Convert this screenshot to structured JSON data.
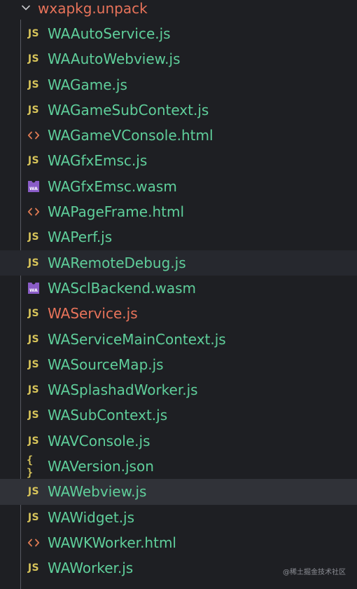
{
  "folder": {
    "label": "wxapkg.unpack",
    "chevron": "chevron-down-icon"
  },
  "files": [
    {
      "label": "WAAutoService.js",
      "type": "js",
      "icon_text": "JS"
    },
    {
      "label": "WAAutoWebview.js",
      "type": "js",
      "icon_text": "JS"
    },
    {
      "label": "WAGame.js",
      "type": "js",
      "icon_text": "JS"
    },
    {
      "label": "WAGameSubContext.js",
      "type": "js",
      "icon_text": "JS"
    },
    {
      "label": "WAGameVConsole.html",
      "type": "html",
      "icon_text": "<>"
    },
    {
      "label": "WAGfxEmsc.js",
      "type": "js",
      "icon_text": "JS"
    },
    {
      "label": "WAGfxEmsc.wasm",
      "type": "wasm",
      "icon_text": "WA"
    },
    {
      "label": "WAPageFrame.html",
      "type": "html",
      "icon_text": "<>"
    },
    {
      "label": "WAPerf.js",
      "type": "js",
      "icon_text": "JS"
    },
    {
      "label": "WARemoteDebug.js",
      "type": "js",
      "icon_text": "JS",
      "state": "hover"
    },
    {
      "label": "WASclBackend.wasm",
      "type": "wasm",
      "icon_text": "WA"
    },
    {
      "label": "WAService.js",
      "type": "js",
      "icon_text": "JS",
      "state": "error"
    },
    {
      "label": "WAServiceMainContext.js",
      "type": "js",
      "icon_text": "JS"
    },
    {
      "label": "WASourceMap.js",
      "type": "js",
      "icon_text": "JS"
    },
    {
      "label": "WASplashadWorker.js",
      "type": "js",
      "icon_text": "JS"
    },
    {
      "label": "WASubContext.js",
      "type": "js",
      "icon_text": "JS"
    },
    {
      "label": "WAVConsole.js",
      "type": "js",
      "icon_text": "JS"
    },
    {
      "label": "WAVersion.json",
      "type": "json",
      "icon_text": "{ }"
    },
    {
      "label": "WAWebview.js",
      "type": "js",
      "icon_text": "JS",
      "state": "selected"
    },
    {
      "label": "WAWidget.js",
      "type": "js",
      "icon_text": "JS"
    },
    {
      "label": "WAWKWorker.html",
      "type": "html",
      "icon_text": "<>"
    },
    {
      "label": "WAWorker.js",
      "type": "js",
      "icon_text": "JS"
    }
  ],
  "watermark": "@稀土掘金技术社区",
  "colors": {
    "background": "#1e1f23",
    "file_label": "#5fcf9b",
    "error_label": "#e8735a",
    "folder_label": "#e8735a",
    "js_icon": "#d7c45a",
    "json_icon": "#d7c45a",
    "html_icon": "#e07b53",
    "wasm_icon": "#8a5cc7",
    "hover_row": "#26282e",
    "selected_row": "#303238"
  }
}
